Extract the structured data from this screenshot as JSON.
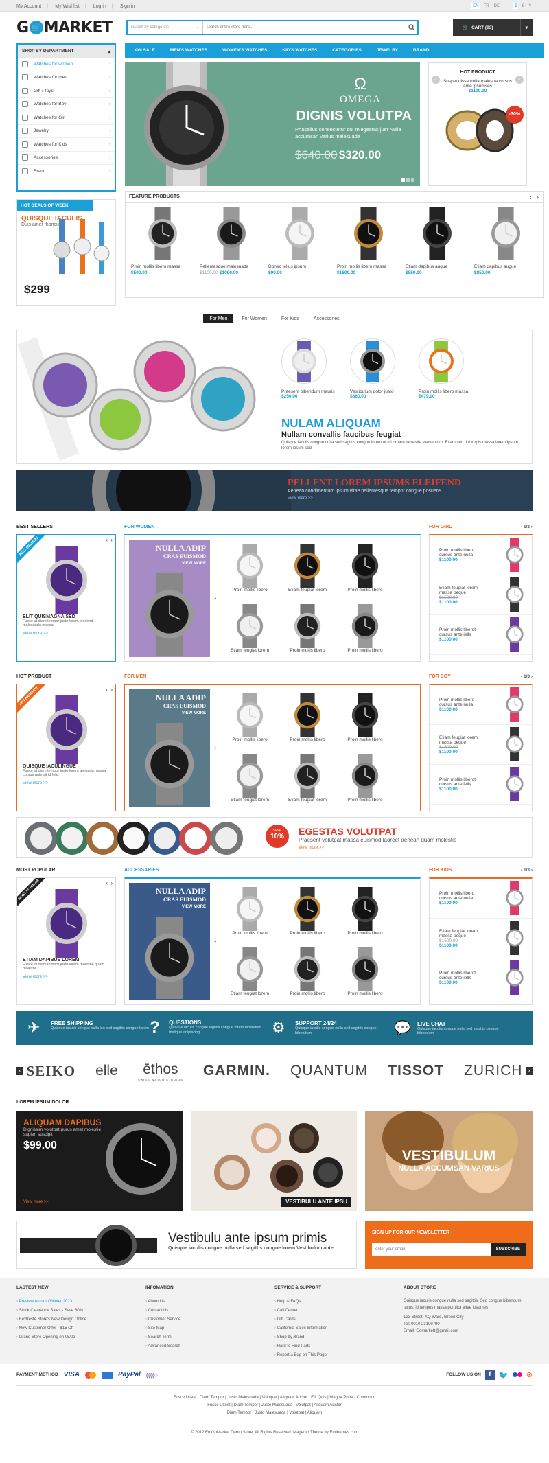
{
  "topbar": {
    "links": [
      "My Account",
      "My Wishlist",
      "Log in",
      "Sign in"
    ],
    "langs": [
      "EN",
      "FR",
      "DE"
    ],
    "currs": [
      "$",
      "€",
      "¥"
    ]
  },
  "header": {
    "logo_prefix": "G",
    "logo_suffix": "MARKET",
    "search_cat": "search by categories",
    "search_placeholder": "search entire store here...",
    "cart": "CART (03)"
  },
  "dept": {
    "title": "SHOP BY DEPARTMENT",
    "items": [
      "Watches for women",
      "Watches for men",
      "Gift / Toys",
      "Watches for Boy",
      "Watches for Girl",
      "Jewelry",
      "Watches for Kids",
      "Accessories",
      "Brand"
    ]
  },
  "menu": [
    "ON SALE",
    "MEN'S WATCHES",
    "WOMEN'S WATCHES",
    "KID'S WATCHES",
    "CATEGORIES",
    "JEWELRY",
    "BRAND"
  ],
  "slider": {
    "brand": "OMEGA",
    "title": "DIGNIS VOLUTPA",
    "text": "Phasellus consectetur dui miegestas just Nulla accumsan varius malesuada",
    "old_price": "$640.00",
    "price": "$320.00"
  },
  "hot": {
    "title": "HOT PRODUCT",
    "name": "Suspendisse nulla malesua cursus ante ipsumses",
    "price": "$1100.00",
    "badge": "-30%"
  },
  "deals": {
    "title": "HOT DEALS OF WEEK",
    "name": "QUISQUE IACULIS",
    "sub": "Duis amet rhoncus",
    "price": "$299"
  },
  "feature": {
    "title": "FEATURE PRODUCTS",
    "items": [
      {
        "name": "Proin mollis libero massa",
        "price": "$590.00"
      },
      {
        "name": "Pellentesque malesuada",
        "old": "$1100.00",
        "price": "$1000.00"
      },
      {
        "name": "Donec tellus ipsum",
        "price": "$90.00"
      },
      {
        "name": "Proin mollis libero massa",
        "price": "$1600.00"
      },
      {
        "name": "Etiam dapibus augue",
        "price": "$850.00"
      },
      {
        "name": "Etiam dapibus augue",
        "price": "$850.00"
      }
    ]
  },
  "tabs": [
    "For Men",
    "For Women",
    "For Kids",
    "Accessories"
  ],
  "showcase": {
    "items": [
      {
        "name": "Praesent bibendum mauris",
        "price": "$250.00"
      },
      {
        "name": "Vestibulum dolor justo",
        "price": "$360.00"
      },
      {
        "name": "Proin mollis libero massa",
        "price": "$479.00"
      }
    ],
    "title": "NULAM ALIQUAM",
    "subtitle": "Nullam convallis faucibus feugiat",
    "text": "Quisque iaculis congue nulla sed sagittis congue lorem ut mi ornare molestie elementum. Etiam sed dui turpis massa lorem ipsum lorem ipsum sed"
  },
  "banner1": {
    "title": "PELLENT LOREM IPSUMS ELEIFEND",
    "text": "Aenean condimentum ipsum vitae pellentesque tempor congue posuere",
    "more": "View more >>"
  },
  "row1": {
    "left_title": "BEST SELLERS",
    "left_ribbon": "BEST SELLERS",
    "left_name": "ELIT QUISMAGNA SED",
    "left_text": "Fusce ut diam tempor justo lorem eleifend malesuada massa",
    "left_more": "View more >>",
    "mid_title": "FOR WOMEN",
    "promo_t1": "NULLA ADIP",
    "promo_t2": "CRAS EUISMOD",
    "promo_more": "VIEW MORE",
    "grid": [
      "Proin mollis libero",
      "Etiam feugiat lorem",
      "Proin mollis libero",
      "Etiam feugiat lorem",
      "Proin mollis libero",
      "Proin mollis libero"
    ],
    "right_title": "FOR GIRL",
    "pager": "1/3",
    "right": [
      {
        "name": "Proin mollis libero cursus ante nulla",
        "price": "$1100.00"
      },
      {
        "name": "Etiam feugiat lorem massa peque",
        "old": "$1500.00",
        "price": "$1100.00"
      },
      {
        "name": "Proin mollis liberot cursus ante iells",
        "price": "$1100.00"
      }
    ]
  },
  "row2": {
    "left_title": "HOT PRODUCT",
    "left_ribbon": "HOT PRODUCT",
    "left_name": "QUISQUE IACULINGUE",
    "left_text": "Fusce ut diam tempor justo lorem aleisada massa cursus ante sit id felis",
    "left_more": "View more >>",
    "mid_title": "FOR MEN",
    "promo_t1": "NULLA ADIP",
    "promo_t2": "CRAS EUISMOD",
    "promo_more": "VIEW MORE",
    "grid": [
      "Proin mollis libero",
      "Proin mollis libero",
      "Proin mollis libero",
      "Etiam feugiat lorem",
      "Etiam feugiat lorem",
      "Proin mollis libero"
    ],
    "right_title": "FOR BOY",
    "pager": "1/3",
    "right": [
      {
        "name": "Proin mollis libero cursus ante nulla",
        "price": "$1100.00"
      },
      {
        "name": "Etiam feugiat lorem massa peque",
        "old": "$1500.00",
        "price": "$1100.00"
      },
      {
        "name": "Proin mollis liberot cursus ante iells",
        "price": "$1100.00"
      }
    ]
  },
  "banner2": {
    "badge_top": "save",
    "badge_pct": "10%",
    "title": "EGESTAS VOLUTPAT",
    "text": "Praesent volutpat massa euismod laoreet aenean quam molestie",
    "more": "View more >>"
  },
  "row3": {
    "left_title": "MOST POPULAR",
    "left_ribbon": "MOST POPULAR",
    "left_name": "ETIAM DAPIBUS LOREM",
    "left_text": "Fusce ut diam tempor justo lorem molestie quam molestie",
    "left_more": "View more >>",
    "mid_title": "ACCESSARIES",
    "promo_t1": "NULLA ADIP",
    "promo_t2": "CRAS EUISMOD",
    "promo_more": "VIEW MORE",
    "grid": [
      "Proin mollis libero",
      "Proin mollis libero",
      "Proin mollis libero",
      "Etiam feugiat lorem",
      "Proin mollis libero",
      "Proin mollis libero"
    ],
    "right_title": "FOR KIDS",
    "pager": "1/3",
    "right": [
      {
        "name": "Proin mollis libero cursus ante nulla",
        "price": "$1100.00"
      },
      {
        "name": "Etiam feugiat lorem massa peque",
        "old": "$1500.00",
        "price": "$1100.00"
      },
      {
        "name": "Proin mollis liberot cursus ante iells",
        "price": "$1100.00"
      }
    ]
  },
  "services": [
    {
      "icon": "plane-icon",
      "title": "FREE SHIPPING",
      "text": "Quisque iaculis congue nulla leo sed sagittis congue lorem"
    },
    {
      "icon": "question-icon",
      "title": "QUESTIONS",
      "text": "Quisque iaculis congue fagittis congue lorem bibendum tristique adipiscing"
    },
    {
      "icon": "support-icon",
      "title": "SUPPORT 24/24",
      "text": "Quisque iaculis congue nulla sed sagittis congue bibendum"
    },
    {
      "icon": "chat-icon",
      "title": "LIVE CHAT",
      "text": "Quisque iaculis congue nulla sed sagittis congue bibendum"
    }
  ],
  "brands": [
    "SEIKO",
    "elle",
    "ēthos",
    "GARMIN.",
    "QUANTUM",
    "TISSOT",
    "ZURICH"
  ],
  "brand_sub": "SWISS WATCH STUDIOS",
  "lorem": {
    "title": "LOREM IPSUM DOLOR",
    "b1_title": "ALIQUAM DAPIBUS",
    "b1_text": "Dignissim volutpat purus amet molestie sapien suscipit",
    "b1_price": "$99.00",
    "b1_more": "View more >>",
    "b2_label": "VESTIBULU ANTE IPSU",
    "b3_title": "VESTIBULUM",
    "b3_sub": "NULLA ACCUMSAN VARIUS"
  },
  "promo": {
    "title": "Vestibulu ante ipsum primis",
    "text": "Quisque iaculis congue nulla sed sagittis congue lorem Vestibulum ante"
  },
  "newsletter": {
    "title": "SIGN UP FOR OUR NEWSLETTER",
    "placeholder": "enter your email",
    "button": "SUBSCRIBE"
  },
  "footer": {
    "cols": [
      {
        "title": "LASTEST NEW",
        "items": [
          "Preview Autumn/Winter 2013",
          "Stock Clearance Sales - Save 80%",
          "Eextreste Store's New Design Online",
          "New Customer Offer - $15 Off",
          "Grand Store Opening on 05/02"
        ]
      },
      {
        "title": "INFOMATION",
        "items": [
          "About Us",
          "Contact Us",
          "Customer Service",
          "Site Map",
          "Search Term",
          "Advanced Search"
        ]
      },
      {
        "title": "SERVICE & SUPPORT",
        "items": [
          "Help & FAQs",
          "Call Center",
          "Gift Cards",
          "California Sales Information",
          "Shop by Brand",
          "Hard to Find Parts",
          "Report a Bug on This Page"
        ]
      }
    ],
    "about_title": "ABOUT STORE",
    "about_text": "Quisque iaculis congue nulla sed sagittis. Sed congue bibendum lacus, id tempus massa porttitor vitae ipsumes",
    "about_addr": "123 Street, XQ Ward, Green City",
    "about_tel": "Tel: 0010 23199790",
    "about_email": "Email: Gomarkett@gmail.com",
    "payment_label": "PAYMENT METHOD",
    "payments": [
      "VISA",
      "PayPal"
    ],
    "follow_label": "FOLLOW US ON",
    "links1": "Fusce Ultest | Diam Tempor | Justo Malesuada | Volutpat | Aliquam Auctor | Elit Quis | Magna Porta | Commodo",
    "links2": "Fusce Ultest | Diam Tempor | Justo Malesuada | Volutpat | Aliquam Auctor",
    "links3": "Diam Tempor | Justo Malesuada | Volutpat | Aliquam",
    "copyright": "© 2012 EmGoMarket Demo Store. All Rights Reserved. Magento Theme by Emthemes.com"
  },
  "colors": {
    "accent": "#1a9fd8",
    "orange": "#ea6a1f",
    "dark": "#333333",
    "services": "#1f6f8b"
  }
}
